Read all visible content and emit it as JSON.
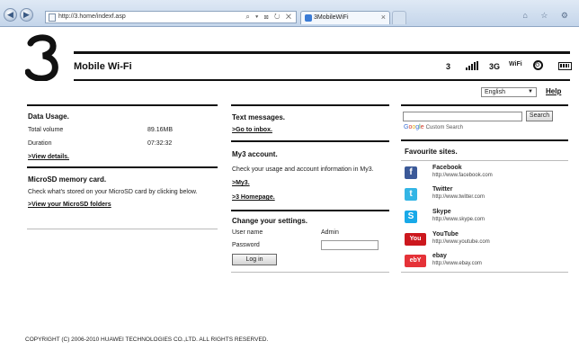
{
  "browser": {
    "back_icon": "back-arrow-icon",
    "forward_icon": "forward-arrow-icon",
    "url": "http://3.home/indexf.asp",
    "address_tools": "⌕ ▾ ⊠ ↻ ✕",
    "tab_title": "3MobileWiFi",
    "tab_close": "×",
    "window_controls": "⌂ ☆ ⚙"
  },
  "header": {
    "title": "Mobile Wi-Fi",
    "network": "3",
    "network_type": "3G",
    "wifi_label": "WiFi"
  },
  "top_links": {
    "language": "English",
    "help": "Help"
  },
  "data_usage": {
    "title": "Data Usage.",
    "total_label": "Total volume",
    "total_value": "89.16MB",
    "duration_label": "Duration",
    "duration_value": "07:32:32",
    "details_link": ">View details."
  },
  "microsd": {
    "title": "MicroSD memory card.",
    "description": "Check what's stored on your MicroSD card by clicking below.",
    "link": ">View your MicroSD folders"
  },
  "messages": {
    "title": "Text messages.",
    "link": ">Go to inbox."
  },
  "my3": {
    "title": "My3 account.",
    "description": "Check your usage and account information in My3.",
    "link_my3": ">My3.",
    "link_home": ">3 Homepage."
  },
  "settings": {
    "title": "Change your settings.",
    "username_label": "User name",
    "username_value": "Admin",
    "password_label": "Password",
    "login_button": "Log in"
  },
  "search": {
    "button": "Search",
    "google_g": "G",
    "google_o1": "o",
    "google_o2": "o",
    "google_g2": "g",
    "google_l": "l",
    "google_e": "e",
    "custom_search": "Custom Search"
  },
  "favourites": {
    "title": "Favourite sites.",
    "items": [
      {
        "name": "Facebook",
        "url": "http://www.facebook.com",
        "icon": "facebook-icon",
        "color": "#3b5998",
        "glyph": "f"
      },
      {
        "name": "Twitter",
        "url": "http://www.twitter.com",
        "icon": "twitter-icon",
        "color": "#33b5e5",
        "glyph": "t"
      },
      {
        "name": "Skype",
        "url": "http://www.skype.com",
        "icon": "skype-icon",
        "color": "#18a9e8",
        "glyph": "S"
      },
      {
        "name": "YouTube",
        "url": "http://www.youtube.com",
        "icon": "youtube-icon",
        "color": "#cc181e",
        "glyph": "You"
      },
      {
        "name": "ebay",
        "url": "http://www.ebay.com",
        "icon": "ebay-icon",
        "color": "#e53238",
        "glyph": "ebY"
      }
    ]
  },
  "footer": {
    "copyright": "COPYRIGHT (C) 2006-2010 HUAWEI TECHNOLOGIES CO.,LTD. ALL RIGHTS RESERVED."
  }
}
